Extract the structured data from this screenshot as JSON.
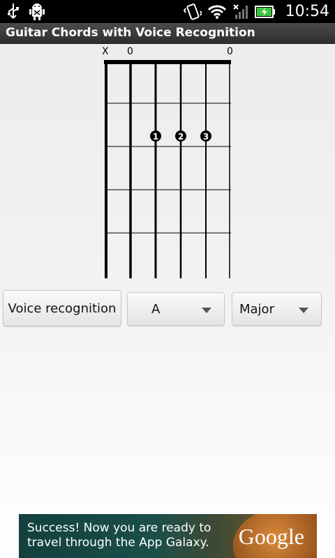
{
  "status_bar": {
    "time": "10:54",
    "left_icons": [
      "usb-icon",
      "android-debug-icon"
    ],
    "right_icons": [
      "vibrate-icon",
      "wifi-icon",
      "signal-icon",
      "battery-charging-icon"
    ]
  },
  "app": {
    "title": "Guitar Chords with Voice Recognition"
  },
  "chord_diagram": {
    "string_markers": [
      "X",
      "0",
      "",
      "",
      "",
      "0"
    ],
    "strings": 6,
    "frets": 5,
    "fingers": [
      {
        "label": "1",
        "string": 3,
        "fret": 2
      },
      {
        "label": "2",
        "string": 4,
        "fret": 2
      },
      {
        "label": "3",
        "string": 5,
        "fret": 2
      }
    ]
  },
  "controls": {
    "voice_button_label": "Voice recognition",
    "note_selected": "A",
    "quality_selected": "Major"
  },
  "ad": {
    "text_line1": "Success! Now you are ready to",
    "text_line2": "travel through the App Galaxy.",
    "brand": "Google"
  },
  "colors": {
    "status_bar": "#000000",
    "title_bar": "#3a3a3a",
    "ad_background": "#1a4f4a"
  }
}
